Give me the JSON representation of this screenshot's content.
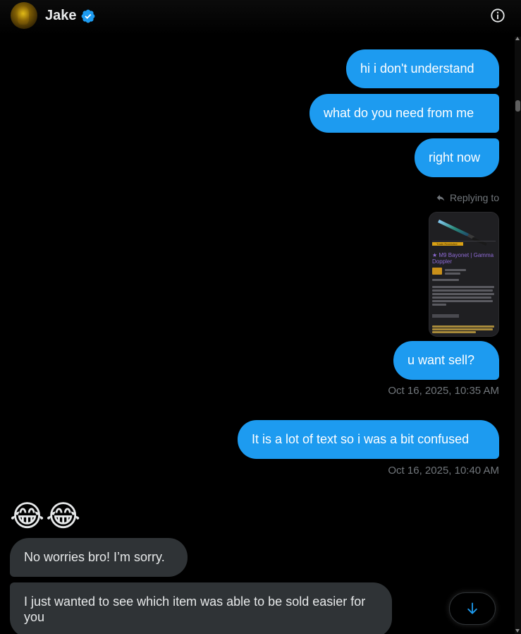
{
  "header": {
    "name": "Jake",
    "verified_icon": "verified-badge-icon",
    "info_icon": "info-icon"
  },
  "messages": {
    "sent": [
      "hi i don't understand",
      "what do you need from me",
      "right now",
      "u want sell?",
      "It is a lot of text so i was a bit confused"
    ],
    "timestamps": [
      "Oct 16, 2025, 10:35 AM",
      "Oct 16, 2025, 10:40 AM"
    ],
    "replying_to": "Replying to",
    "emoji": "😂😂",
    "received": [
      "No worries bro! I’m sorry.",
      "I just wanted to see which item was able to be sold easier for you"
    ]
  },
  "preview": {
    "tag": "Trade Restricted",
    "title": "★ M9 Bayonet | Gamma Doppler"
  },
  "colors": {
    "sent_bubble": "#1d9bf0",
    "received_bubble": "#2f3336",
    "muted_text": "#71767b",
    "background": "#000000"
  },
  "scroll_button_icon": "arrow-down-icon"
}
